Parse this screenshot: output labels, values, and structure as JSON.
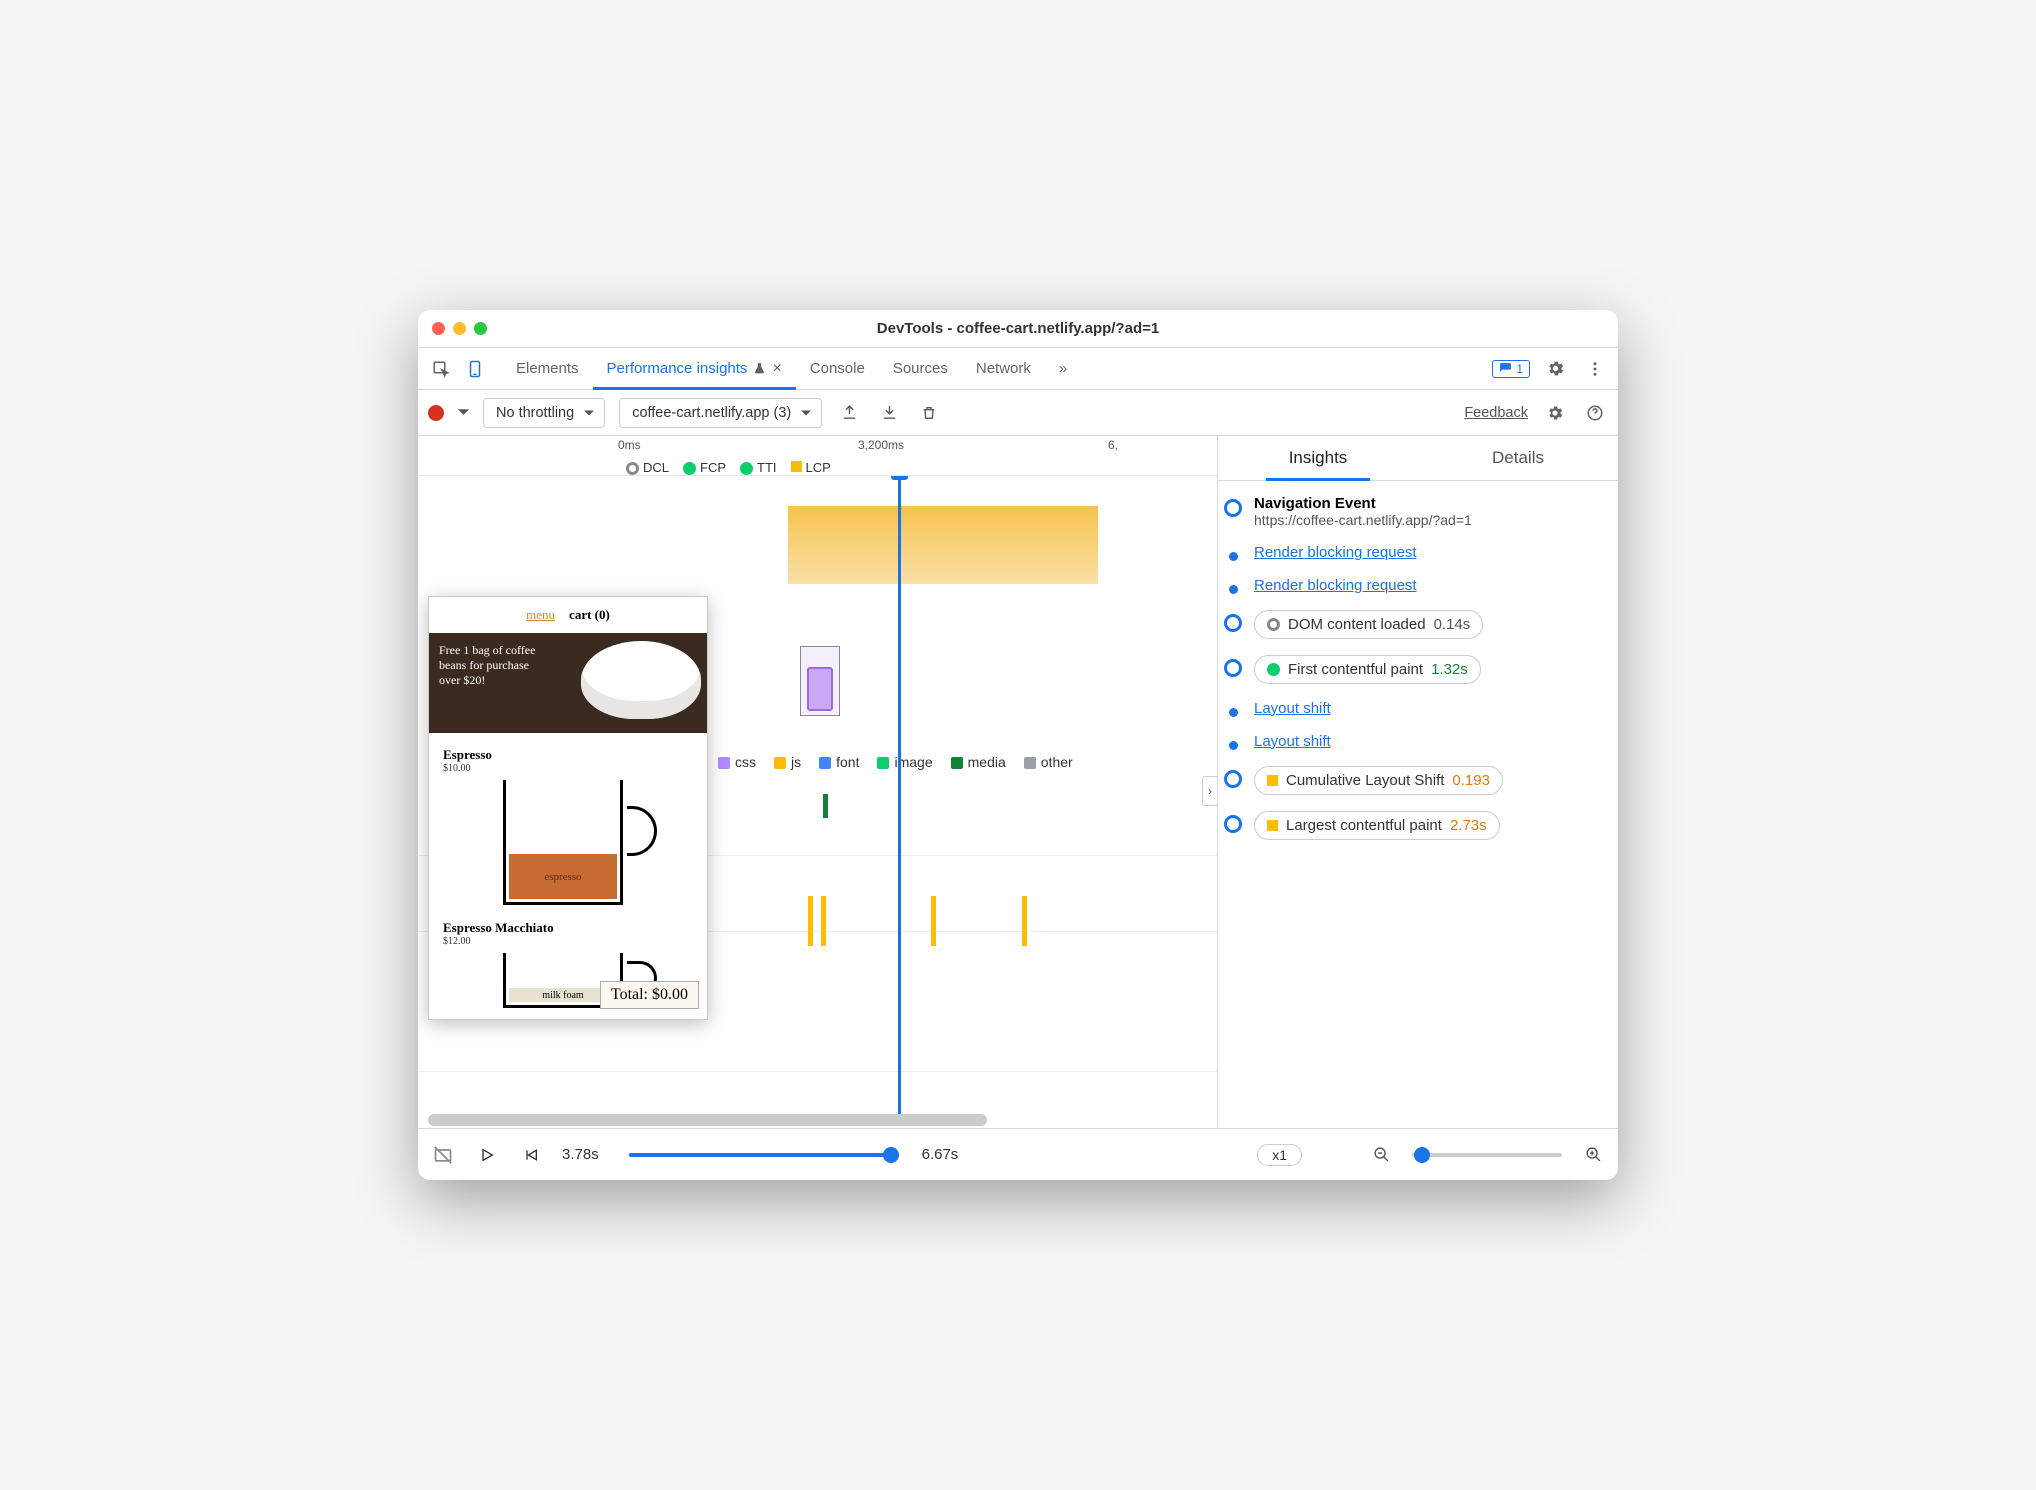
{
  "window": {
    "title": "DevTools - coffee-cart.netlify.app/?ad=1"
  },
  "tabs": {
    "items": [
      "Elements",
      "Performance insights",
      "Console",
      "Sources",
      "Network"
    ],
    "activeIndex": 1,
    "issuesBadge": "1"
  },
  "toolbar": {
    "throttling": "No throttling",
    "recording": "coffee-cart.netlify.app (3)",
    "feedback": "Feedback"
  },
  "timeline": {
    "ticks": [
      "0ms",
      "3,200ms",
      "6,"
    ],
    "markers": {
      "dcl": "DCL",
      "fcp": "FCP",
      "tti": "TTI",
      "lcp": "LCP"
    },
    "legend": {
      "css": "css",
      "js": "js",
      "font": "font",
      "image": "image",
      "media": "media",
      "other": "other"
    }
  },
  "thumb": {
    "nav": {
      "menu": "menu",
      "cart": "cart (0)"
    },
    "heroText": "Free 1 bag of coffee beans for purchase over $20!",
    "items": [
      {
        "name": "Espresso",
        "price": "$10.00",
        "fill": "espresso"
      },
      {
        "name": "Espresso Macchiato",
        "price": "$12.00",
        "fill": "milk foam"
      }
    ],
    "total": "Total: $0.00"
  },
  "rightPane": {
    "tabs": [
      "Insights",
      "Details"
    ],
    "activeIndex": 0,
    "insights": {
      "nav": {
        "title": "Navigation Event",
        "url": "https://coffee-cart.netlify.app/?ad=1"
      },
      "links": {
        "rbr": "Render blocking request",
        "ls": "Layout shift"
      },
      "metrics": {
        "dcl": {
          "label": "DOM content loaded",
          "value": "0.14s"
        },
        "fcp": {
          "label": "First contentful paint",
          "value": "1.32s"
        },
        "cls": {
          "label": "Cumulative Layout Shift",
          "value": "0.193"
        },
        "lcp": {
          "label": "Largest contentful paint",
          "value": "2.73s"
        }
      }
    }
  },
  "footer": {
    "current": "3.78s",
    "end": "6.67s",
    "zoom": "x1"
  },
  "colors": {
    "blue": "#1a73e8",
    "green": "#0cce6b",
    "amber": "#fbbc04",
    "purple": "#b388ff",
    "teal": "#178038",
    "orange": "#d97a0b",
    "gray": "#9aa0a6"
  }
}
